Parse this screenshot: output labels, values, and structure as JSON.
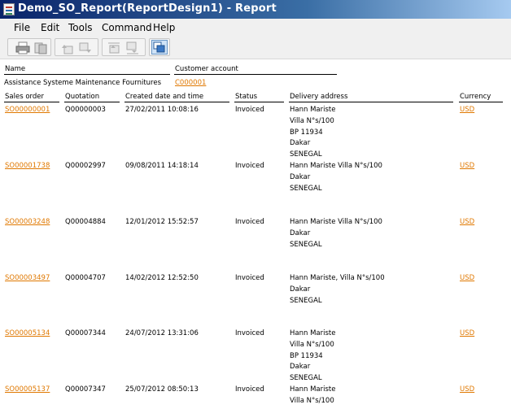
{
  "window": {
    "title": "Demo_SO_Report(ReportDesign1) - Report"
  },
  "menu": [
    "File",
    "Edit",
    "Tools",
    "Command",
    "Help"
  ],
  "toolbar": {
    "buttons": [
      "print-icon",
      "export-icon",
      "page-up-icon",
      "page-down-icon",
      "first-page-icon",
      "last-page-icon",
      "layout-icon"
    ]
  },
  "customer": {
    "name_header": "Name",
    "account_header": "Customer account",
    "name": "Assistance Systeme Maintenance Fournitures",
    "account": "C000001"
  },
  "columns": {
    "sales_order": "Sales order",
    "quotation": "Quotation",
    "created": "Created date and time",
    "status": "Status",
    "delivery": "Delivery address",
    "currency": "Currency"
  },
  "rows": [
    {
      "sales_order": "SO00000001",
      "quotation": "Q00000003",
      "created": "27/02/2011 10:08:16",
      "status": "Invoiced",
      "address": [
        "Hann Mariste",
        "Villa N°s/100",
        "BP 11934",
        "Dakar",
        "SENEGAL"
      ],
      "currency": "USD"
    },
    {
      "sales_order": "SO00001738",
      "quotation": "Q00002997",
      "created": "09/08/2011 14:18:14",
      "status": "Invoiced",
      "address": [
        "Hann Mariste Villa N°s/100",
        "Dakar",
        "SENEGAL"
      ],
      "currency": "USD"
    },
    {
      "sales_order": "SO00003248",
      "quotation": "Q00004884",
      "created": "12/01/2012 15:52:57",
      "status": "Invoiced",
      "address": [
        "Hann Mariste Villa N°s/100",
        "Dakar",
        "SENEGAL"
      ],
      "currency": "USD"
    },
    {
      "sales_order": "SO00003497",
      "quotation": "Q00004707",
      "created": "14/02/2012 12:52:50",
      "status": "Invoiced",
      "address": [
        "Hann Mariste, Villa N°s/100",
        "Dakar",
        "SENEGAL"
      ],
      "currency": "USD"
    },
    {
      "sales_order": "SO00005134",
      "quotation": "Q00007344",
      "created": "24/07/2012 13:31:06",
      "status": "Invoiced",
      "address": [
        "Hann Mariste",
        "Villa N°s/100",
        "BP 11934",
        "Dakar",
        "SENEGAL"
      ],
      "currency": "USD"
    },
    {
      "sales_order": "SO00005137",
      "quotation": "Q00007347",
      "created": "25/07/2012 08:50:13",
      "status": "Invoiced",
      "address": [
        "Hann Mariste",
        "Villa N°s/100"
      ],
      "currency": "USD"
    }
  ]
}
